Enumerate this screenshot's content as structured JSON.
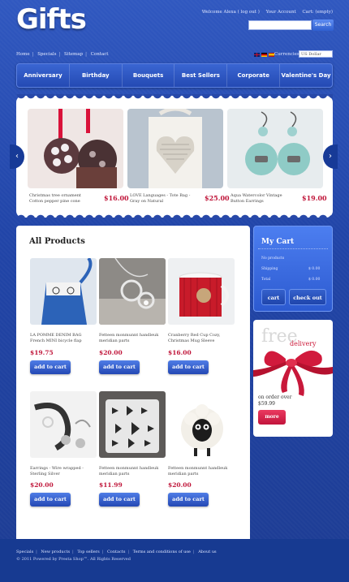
{
  "header": {
    "logo": "Gifts",
    "welcome": "Welcome Alexa ( log out )",
    "account": "Your Account",
    "cart": "Cart: (empty)",
    "search_placeholder": "",
    "search_button": "Search"
  },
  "nav_links": [
    "Home",
    "Specials",
    "Sitemap",
    "Contact"
  ],
  "currency": {
    "label": "Currencies",
    "selected": "US Dollar"
  },
  "menu": [
    "Anniversary",
    "Birthday",
    "Bouquets",
    "Best Sellers",
    "Corporate",
    "Valentine's Day"
  ],
  "slider": [
    {
      "caption": "Christmas tree ornament Cotton pepper pine cone",
      "price": "$16.00"
    },
    {
      "caption": "LOVE Languages - Tote Bag - Gray on Natural",
      "price": "$25.00"
    },
    {
      "caption": "Aqua Watercolor Vintage Button Earrings",
      "price": "$19.00"
    }
  ],
  "products": {
    "title": "All Products",
    "items": [
      {
        "name": "LA POMME DENIM BAG French MINI bicycle flap",
        "price": "$19.75",
        "button": "add to cart"
      },
      {
        "name": "Fetteen monmunnt handleuk meridian parts",
        "price": "$20.00",
        "button": "add to cart"
      },
      {
        "name": "Cranberry Red Cup Cozy, Christmas Mug Sleeve",
        "price": "$16.00",
        "button": "add to cart"
      },
      {
        "name": "Earrings - Wire wrapped - Sterling Silver",
        "price": "$20.00",
        "button": "add to cart"
      },
      {
        "name": "Fetteen monmunnt handleuk meridian parts",
        "price": "$11.99",
        "button": "add to cart"
      },
      {
        "name": "Fetteen monmunnt handleuk meridian parts",
        "price": "$20.00",
        "button": "add to cart"
      }
    ]
  },
  "mycart": {
    "title": "My Cart",
    "no_products": "No products",
    "shipping_label": "Shipping",
    "shipping_value": "$ 0.00",
    "total_label": "Total",
    "total_value": "$ 0.00",
    "cart_button": "cart",
    "checkout_button": "check out"
  },
  "promo": {
    "free": "free",
    "delivery": "delivery",
    "order_text": "on order over",
    "amount": "$59.99",
    "more": "more"
  },
  "footer": {
    "links": [
      "Specials",
      "New products",
      "Top sellers",
      "Contacts",
      "Terms and conditions of use",
      "About us"
    ],
    "copyright": "© 2011 Powered by Presta Shop™. All Rights Reserved"
  },
  "colors": {
    "accent_red": "#c0163a",
    "brand_blue": "#2145a8"
  }
}
